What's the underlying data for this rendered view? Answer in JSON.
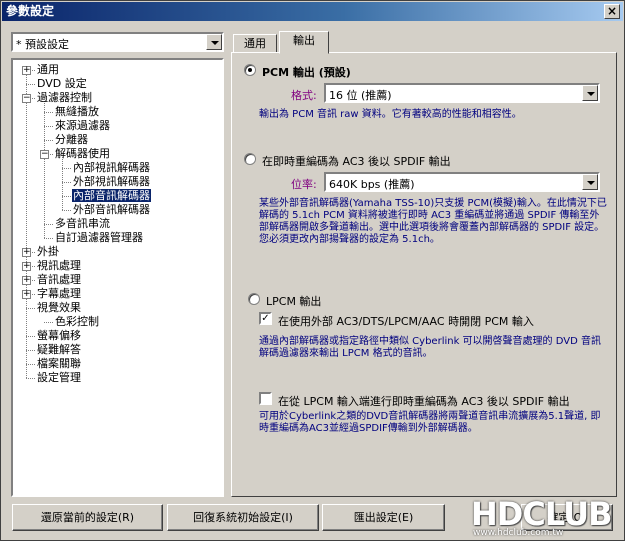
{
  "window": {
    "title": "參數設定",
    "close_symbol": "×"
  },
  "preset": {
    "value": "* 預設設定"
  },
  "tree": {
    "items": [
      {
        "label": "通用",
        "expander": "+"
      },
      {
        "label": "DVD 設定",
        "expander": ""
      },
      {
        "label": "過濾器控制",
        "expander": "−"
      },
      {
        "label": "無縫播放",
        "expander": ""
      },
      {
        "label": "來源過濾器",
        "expander": ""
      },
      {
        "label": "分離器",
        "expander": ""
      },
      {
        "label": "解碼器使用",
        "expander": "−"
      },
      {
        "label": "內部視訊解碼器",
        "expander": ""
      },
      {
        "label": "外部視訊解碼器",
        "expander": ""
      },
      {
        "label": "內部音訊解碼器",
        "expander": "",
        "selected": true
      },
      {
        "label": "外部音訊解碼器",
        "expander": ""
      },
      {
        "label": "多音訊串流",
        "expander": ""
      },
      {
        "label": "自訂過濾器管理器",
        "expander": ""
      },
      {
        "label": "外掛",
        "expander": "+"
      },
      {
        "label": "視訊處理",
        "expander": "+"
      },
      {
        "label": "音訊處理",
        "expander": "+"
      },
      {
        "label": "字幕處理",
        "expander": "+"
      },
      {
        "label": "視覺效果",
        "expander": ""
      },
      {
        "label": "色彩控制",
        "expander": ""
      },
      {
        "label": "螢幕偏移",
        "expander": ""
      },
      {
        "label": "疑難解答",
        "expander": ""
      },
      {
        "label": "檔案關聯",
        "expander": ""
      },
      {
        "label": "設定管理",
        "expander": ""
      }
    ]
  },
  "tabs": [
    {
      "label": "通用"
    },
    {
      "label": "輸出"
    }
  ],
  "output": {
    "pcm": {
      "label": "PCM 輸出 (預設)",
      "format_label": "格式:",
      "format_value": "16 位 (推薦)",
      "description": "輸出為 PCM 音訊 raw 資料。它有著較高的性能和相容性。"
    },
    "ac3": {
      "label": "在即時重編碼為 AC3 後以 SPDIF 輸出",
      "bitrate_label": "位率:",
      "bitrate_value": "640K bps (推薦)",
      "description": "某些外部音訊解碼器(Yamaha TSS-10)只支援 PCM(模擬)輸入。在此情況下已解碼的 5.1ch PCM 資料將被進行即時 AC3 重編碼並將通過 SPDIF 傳輸至外部解碼器開啟多聲道輸出。選中此選項後將會覆蓋內部解碼器的 SPDIF 設定。您必須更改內部揚聲器的設定為 5.1ch。"
    },
    "lpcm": {
      "label": "LPCM 輸出",
      "option_label": "在使用外部 AC3/DTS/LPCM/AAC 時開閉 PCM 輸入",
      "option_checked": true,
      "description": "通過內部解碼器或指定路徑中類似 Cyberlink 可以開啓聲音處理的 DVD 音訊解碼過濾器來輸出 LPCM 格式的音訊。"
    },
    "lpcm_ac3": {
      "label": "在從 LPCM 輸入端進行即時重編碼為 AC3 後以 SPDIF 輸出",
      "checked": false,
      "description": "可用於Cyberlink之類的DVD音訊解碼器將兩聲道音訊串流擴展為5.1聲道, 即時重編碼為AC3並經過SPDIF傳輸到外部解碼器。"
    }
  },
  "buttons": {
    "restore": "還原當前的設定(R)",
    "defaults": "回復系統初始設定(I)",
    "export": "匯出設定(E)",
    "ok": "確定(O)"
  },
  "watermark": {
    "logo": "HDCLUB",
    "url": "www.hdclub.com.tw"
  }
}
